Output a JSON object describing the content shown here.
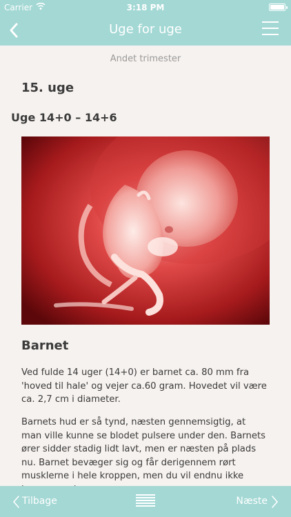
{
  "status_bar": {
    "carrier": "Carrier",
    "time": "3:18 PM",
    "battery_level": 1.0
  },
  "nav": {
    "title": "Uge for uge",
    "back_icon": "chevron-left-icon",
    "menu_icon": "hamburger-menu-icon"
  },
  "content": {
    "trimester": "Andet trimester",
    "week_title": "15. uge",
    "week_range": "Uge 14+0 – 14+6",
    "section_title": "Barnet",
    "paragraphs": [
      "Ved fulde 14 uger (14+0) er barnet ca. 80 mm fra 'hoved til hale' og vejer ca.60 gram. Hovedet vil være ca. 2,7 cm i diameter.",
      "Barnets hud er så tynd, næsten gennemsigtig, at man ville kunne se blodet pulsere under den. Barnets ører sidder stadig lidt lavt, men er næsten på plads nu. Barnet bevæger sig og får derigennem rørt musklerne i hele kroppen, men du vil endnu ikke kunne mærke"
    ]
  },
  "toolbar": {
    "back_label": "Tilbage",
    "next_label": "Næste",
    "list_icon": "text-list-icon"
  },
  "colors": {
    "bar": "#a3d8d4",
    "background": "#f6f2ef",
    "text": "#3a3a3a",
    "muted": "#9a9a9a"
  }
}
